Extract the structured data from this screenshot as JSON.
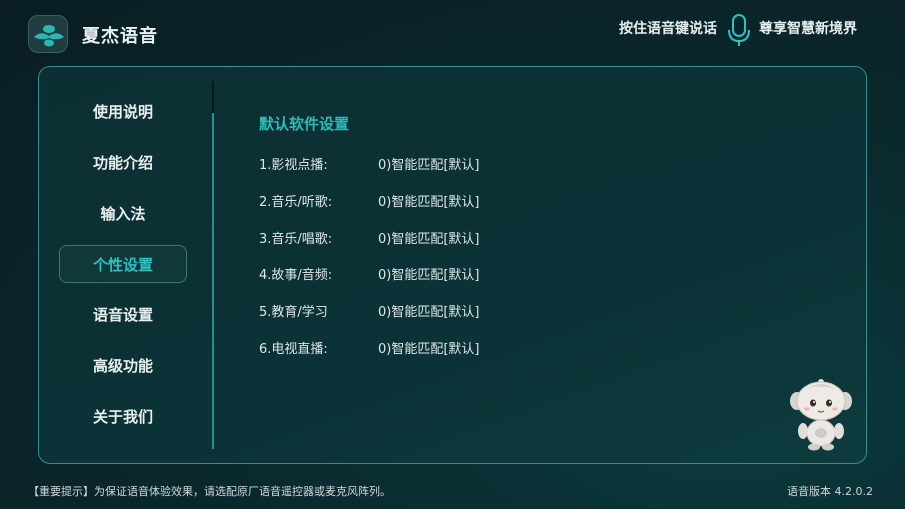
{
  "header": {
    "app_title": "夏杰语音",
    "voice_hint": "按住语音键说话",
    "brand_slogan": "尊享智慧新境界",
    "logo_icon": "bee-logo-icon",
    "mic_icon": "microphone-icon"
  },
  "sidebar": {
    "items": [
      {
        "label": "使用说明",
        "active": false
      },
      {
        "label": "功能介绍",
        "active": false
      },
      {
        "label": "输入法",
        "active": false
      },
      {
        "label": "个性设置",
        "active": true
      },
      {
        "label": "语音设置",
        "active": false
      },
      {
        "label": "高级功能",
        "active": false
      },
      {
        "label": "关于我们",
        "active": false
      }
    ]
  },
  "content": {
    "section_title": "默认软件设置",
    "settings": [
      {
        "label": "1.影视点播:",
        "value": "0)智能匹配[默认]"
      },
      {
        "label": "2.音乐/听歌:",
        "value": "0)智能匹配[默认]"
      },
      {
        "label": "3.音乐/唱歌:",
        "value": "0)智能匹配[默认]"
      },
      {
        "label": "4.故事/音频:",
        "value": "0)智能匹配[默认]"
      },
      {
        "label": "5.教育/学习",
        "value": "0)智能匹配[默认]"
      },
      {
        "label": "6.电视直播:",
        "value": "0)智能匹配[默认]"
      }
    ]
  },
  "footer": {
    "notice": "【重要提示】为保证语音体验效果，请选配原厂语音遥控器或麦克风阵列。",
    "version": "语音版本 4.2.0.2"
  },
  "colors": {
    "accent": "#29bcba",
    "border": "#2f8f8f",
    "background": "#0a2a2e"
  }
}
